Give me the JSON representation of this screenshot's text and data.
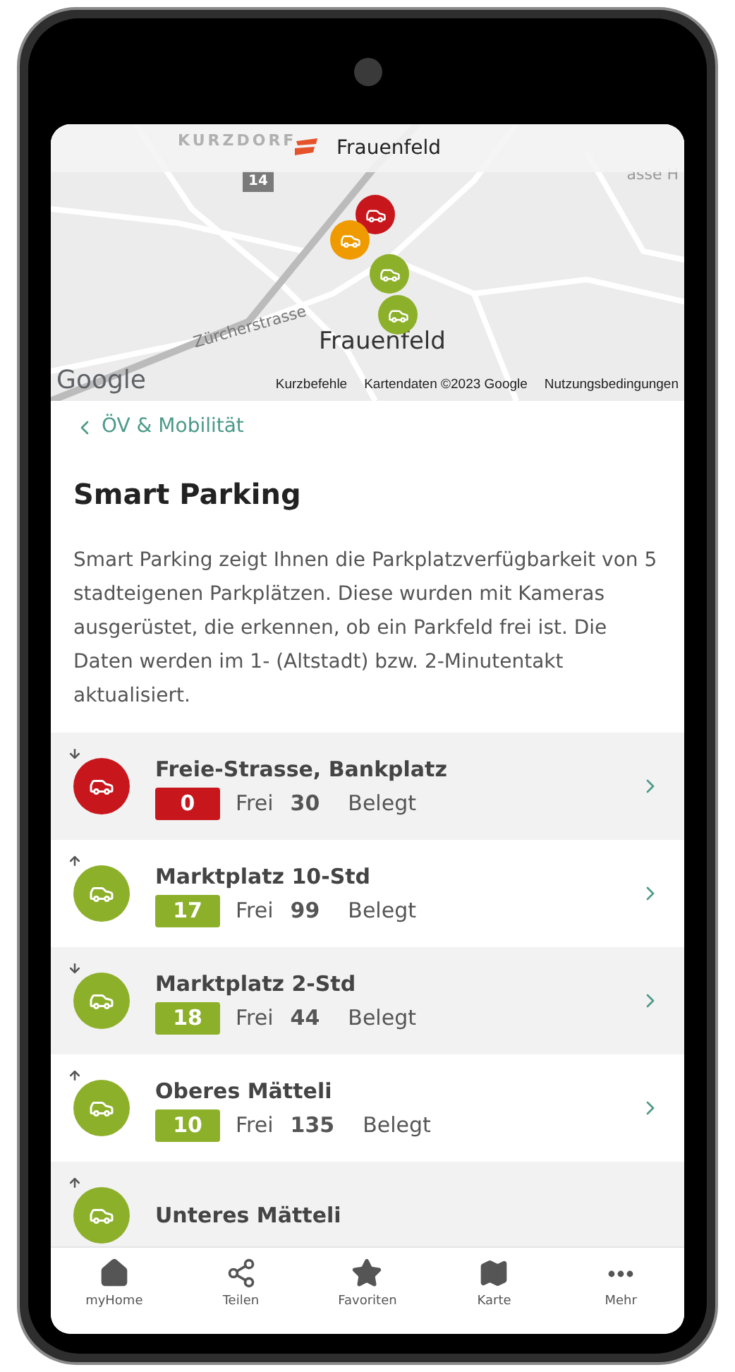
{
  "header": {
    "title": "Frauenfeld"
  },
  "map": {
    "labels": [
      {
        "kind": "district",
        "text": "KURZDORF"
      },
      {
        "kind": "shield",
        "text": "14"
      },
      {
        "kind": "street",
        "text": "Zürcherstrasse"
      },
      {
        "kind": "street-edge",
        "text": "asse  H"
      },
      {
        "kind": "city",
        "text": "Frauenfeld"
      }
    ],
    "pins": [
      {
        "color": "#c8161d"
      },
      {
        "color": "#ef9b00"
      },
      {
        "color": "#8db02b"
      },
      {
        "color": "#8db02b"
      }
    ],
    "logo": "Google",
    "links": [
      "Kurzbefehle",
      "Kartendaten ©2023 Google",
      "Nutzungsbedingungen"
    ]
  },
  "back_link": "ÖV & Mobilität",
  "title": "Smart Parking",
  "description": "Smart Parking zeigt Ihnen die Parkplatzverfügbarkeit von 5 stadteigenen Parkplätzen. Diese wurden mit Kameras ausgerüstet, die erkennen, ob ein Parkfeld frei ist. Die Daten werden im 1- (Altstadt) bzw. 2-Minutentakt aktualisiert.",
  "parkings": [
    {
      "name": "Freie-Strasse, Bankplatz",
      "rising": false,
      "color": "#c8161d",
      "free": "0",
      "free_label": "Frei",
      "occupied": "30",
      "occupied_label": "Belegt"
    },
    {
      "name": "Marktplatz 10-Std",
      "rising": true,
      "color": "#8db02b",
      "free": "17",
      "free_label": "Frei",
      "occupied": "99",
      "occupied_label": "Belegt"
    },
    {
      "name": "Marktplatz 2-Std",
      "rising": false,
      "color": "#8db02b",
      "free": "18",
      "free_label": "Frei",
      "occupied": "44",
      "occupied_label": "Belegt"
    },
    {
      "name": "Oberes Mätteli",
      "rising": true,
      "color": "#8db02b",
      "free": "10",
      "free_label": "Frei",
      "occupied": "135",
      "occupied_label": "Belegt"
    },
    {
      "name": "Unteres Mätteli",
      "rising": true,
      "color": "#8db02b"
    }
  ],
  "nav": [
    {
      "kind": "home",
      "label": "myHome"
    },
    {
      "kind": "share",
      "label": "Teilen"
    },
    {
      "kind": "star",
      "label": "Favoriten"
    },
    {
      "kind": "map",
      "label": "Karte"
    },
    {
      "kind": "more",
      "label": "Mehr"
    }
  ]
}
